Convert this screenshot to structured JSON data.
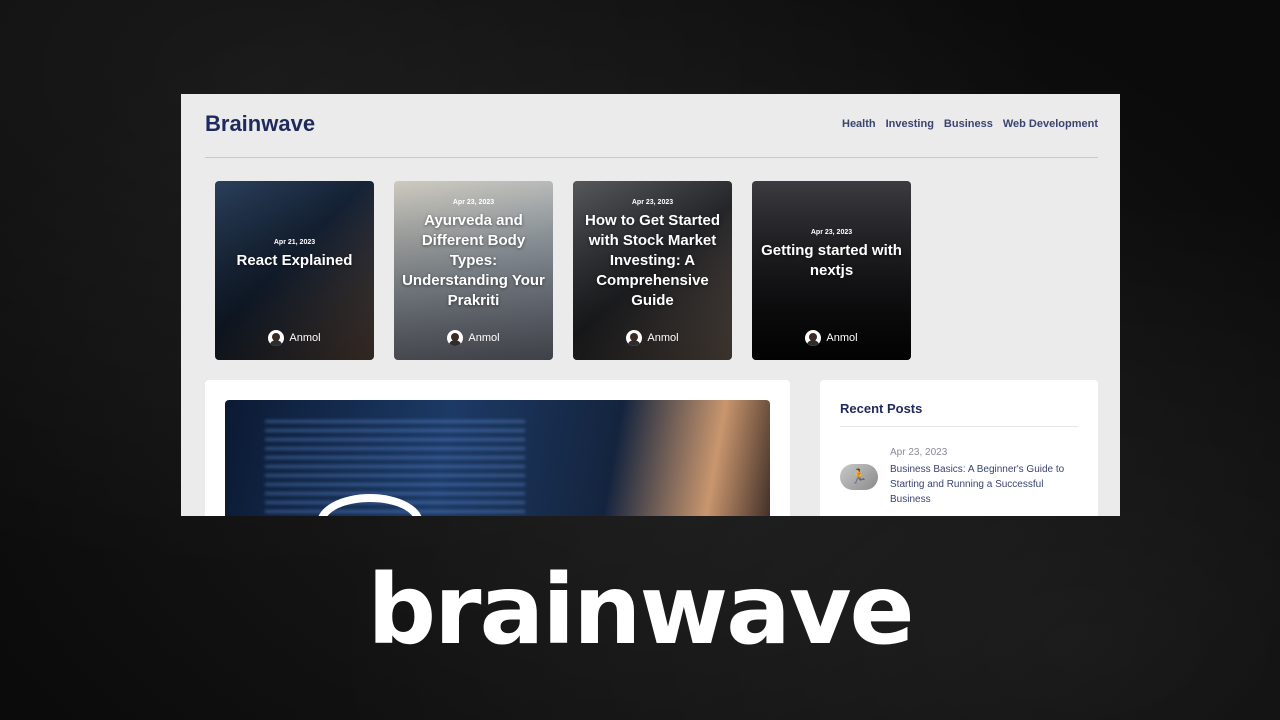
{
  "site": {
    "logo": "Brainwave",
    "nav": [
      "Health",
      "Investing",
      "Business",
      "Web Development"
    ]
  },
  "featured_posts": [
    {
      "date": "Apr 21, 2023",
      "title": "React Explained",
      "author": "Anmol"
    },
    {
      "date": "Apr 23, 2023",
      "title": "Ayurveda and Different Body Types: Understanding Your Prakriti",
      "author": "Anmol"
    },
    {
      "date": "Apr 23, 2023",
      "title": "How to Get Started with Stock Market Investing: A Comprehensive Guide",
      "author": "Anmol"
    },
    {
      "date": "Apr 23, 2023",
      "title": "Getting started with nextjs",
      "author": "Anmol"
    }
  ],
  "sidebar": {
    "title": "Recent Posts",
    "items": [
      {
        "date": "Apr 23, 2023",
        "title": "Business Basics: A Beginner's Guide to Starting and Running a Successful Business"
      }
    ]
  },
  "caption": "brainwave",
  "colors": {
    "brand": "#1f2a5c",
    "page_bg": "#ebebeb",
    "backdrop": "#111111"
  }
}
